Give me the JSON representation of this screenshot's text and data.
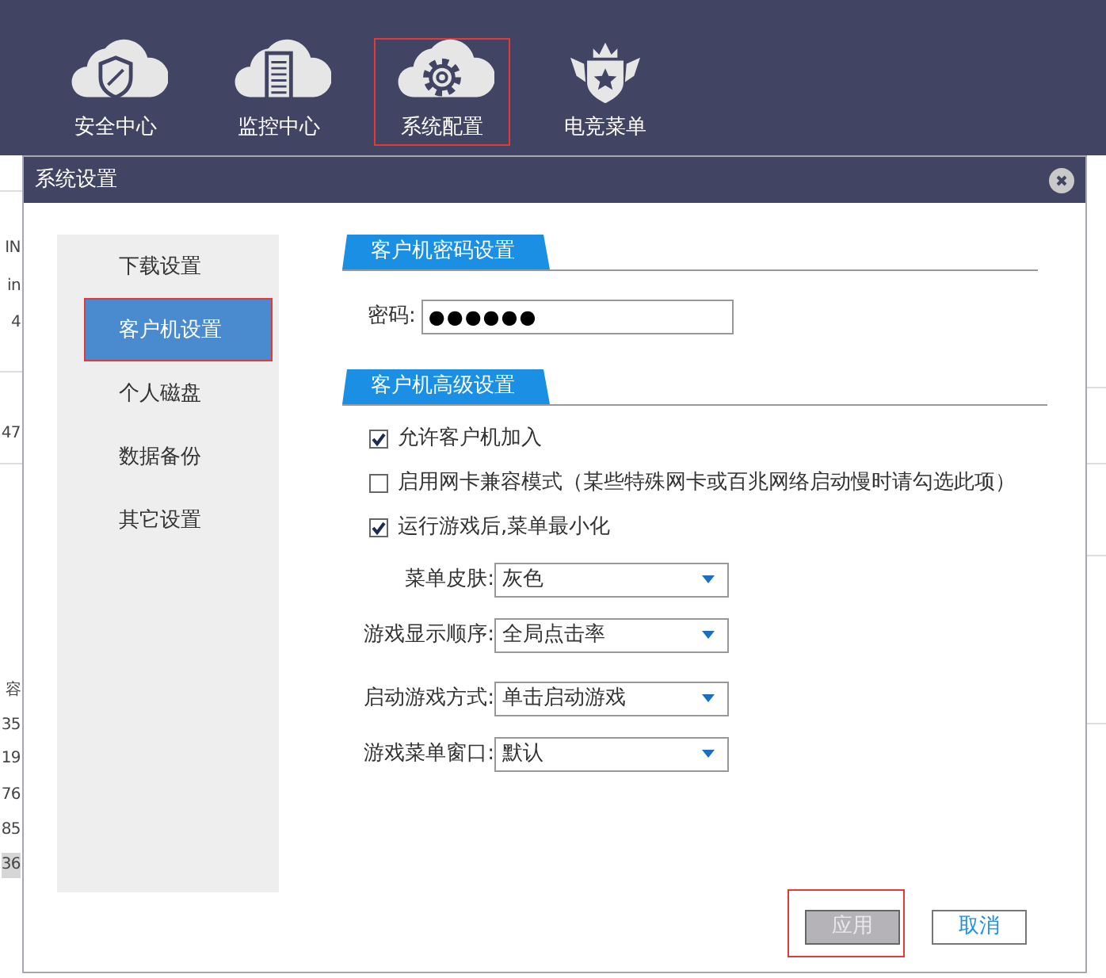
{
  "toolbar": {
    "items": [
      {
        "label": "安全中心",
        "kind": "shield",
        "highlighted": false
      },
      {
        "label": "监控中心",
        "kind": "document",
        "highlighted": false
      },
      {
        "label": "系统配置",
        "kind": "gear",
        "highlighted": true
      },
      {
        "label": "电竞菜单",
        "kind": "crown",
        "highlighted": false
      }
    ]
  },
  "background": {
    "left_fragments": [
      "IN",
      "in",
      "4",
      "47",
      "容",
      "35",
      "19",
      "76",
      "85",
      "36"
    ]
  },
  "dialog": {
    "title": "系统设置",
    "sidebar": [
      {
        "label": "下载设置",
        "selected": false,
        "highlighted": false
      },
      {
        "label": "客户机设置",
        "selected": true,
        "highlighted": true
      },
      {
        "label": "个人磁盘",
        "selected": false,
        "highlighted": false
      },
      {
        "label": "数据备份",
        "selected": false,
        "highlighted": false
      },
      {
        "label": "其它设置",
        "selected": false,
        "highlighted": false
      }
    ],
    "password_section": {
      "title": "客户机密码设置",
      "label": "密码:",
      "value": "●●●●●●"
    },
    "advanced_section": {
      "title": "客户机高级设置",
      "options": [
        {
          "label": "允许客户机加入",
          "checked": true
        },
        {
          "label": "启用网卡兼容模式（某些特殊网卡或百兆网络启动慢时请勾选此项）",
          "checked": false
        },
        {
          "label": "运行游戏后,菜单最小化",
          "checked": true
        }
      ],
      "selects": [
        {
          "label": "菜单皮肤:",
          "value": "灰色"
        },
        {
          "label": "游戏显示顺序:",
          "value": "全局点击率"
        },
        {
          "label": "启动游戏方式:",
          "value": "单击启动游戏"
        },
        {
          "label": "游戏菜单窗口:",
          "value": "默认"
        }
      ]
    },
    "buttons": [
      {
        "label": "应用",
        "disabled": true,
        "highlighted": true
      },
      {
        "label": "取消",
        "disabled": false,
        "highlighted": false
      }
    ]
  }
}
